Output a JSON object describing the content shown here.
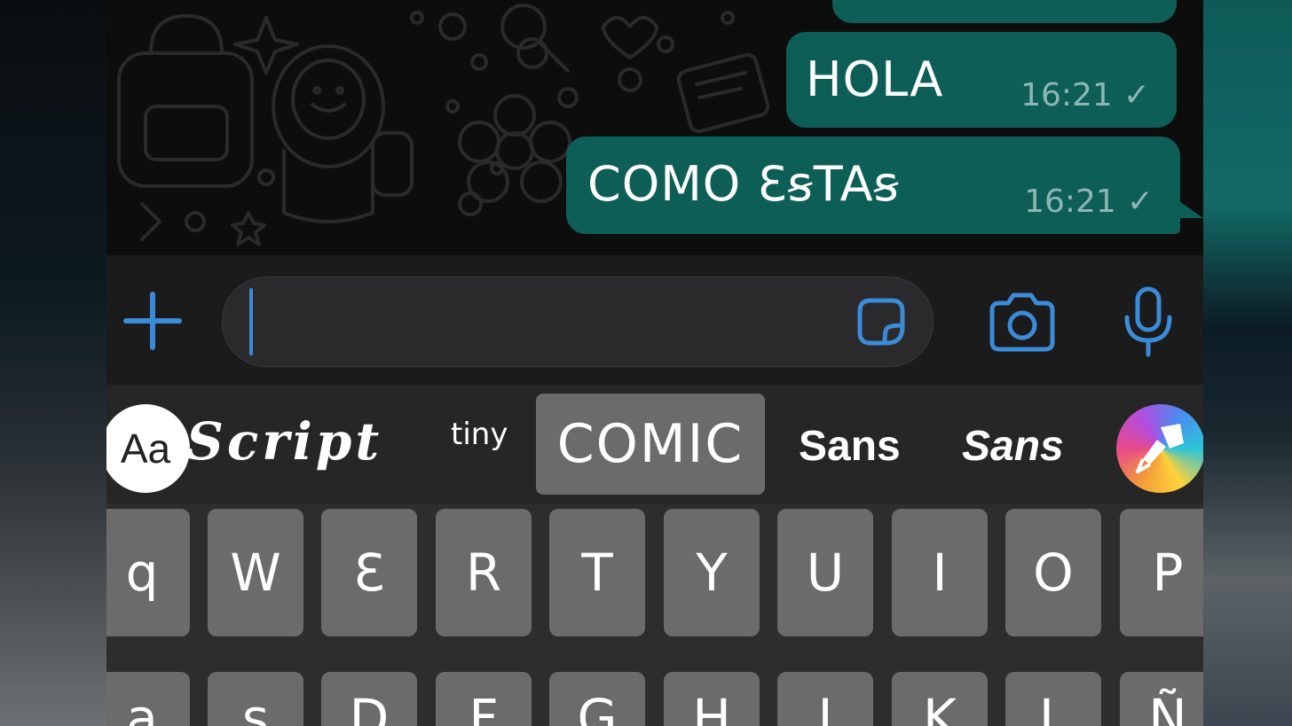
{
  "chat": {
    "messages": [
      {
        "text": "HOLA",
        "time": "16:21",
        "status": "sent"
      },
      {
        "text": "COMO ƐꞩTAꞩ",
        "time": "16:21",
        "status": "sent"
      }
    ],
    "check_glyph": "✓"
  },
  "composer": {
    "attach_icon": "plus-icon",
    "sticker_icon": "sticker-icon",
    "camera_icon": "camera-icon",
    "mic_icon": "microphone-icon",
    "input_value": ""
  },
  "font_bar": {
    "aa_label": "Aa",
    "options": [
      {
        "label": "Script",
        "style": "script"
      },
      {
        "label": "tiny",
        "style": "tiny"
      },
      {
        "label": "COMIC",
        "style": "comic",
        "selected": true
      },
      {
        "label": "Sans",
        "style": "sans-bold"
      },
      {
        "label": "Sans",
        "style": "sans-bold-italic"
      }
    ],
    "brush_icon": "paintbrush-icon"
  },
  "keyboard": {
    "row1": [
      "q",
      "W",
      "Ɛ",
      "R",
      "T",
      "Y",
      "U",
      "I",
      "O",
      "P"
    ],
    "row2_partial": [
      "a",
      "s",
      "D",
      "F",
      "G",
      "H",
      "J",
      "K",
      "L",
      "Ñ"
    ]
  },
  "colors": {
    "bubble": "#0e5e58",
    "accent": "#3a8bd8",
    "key": "#6b6b6b",
    "keyboard_bg": "#2d2d2d"
  }
}
